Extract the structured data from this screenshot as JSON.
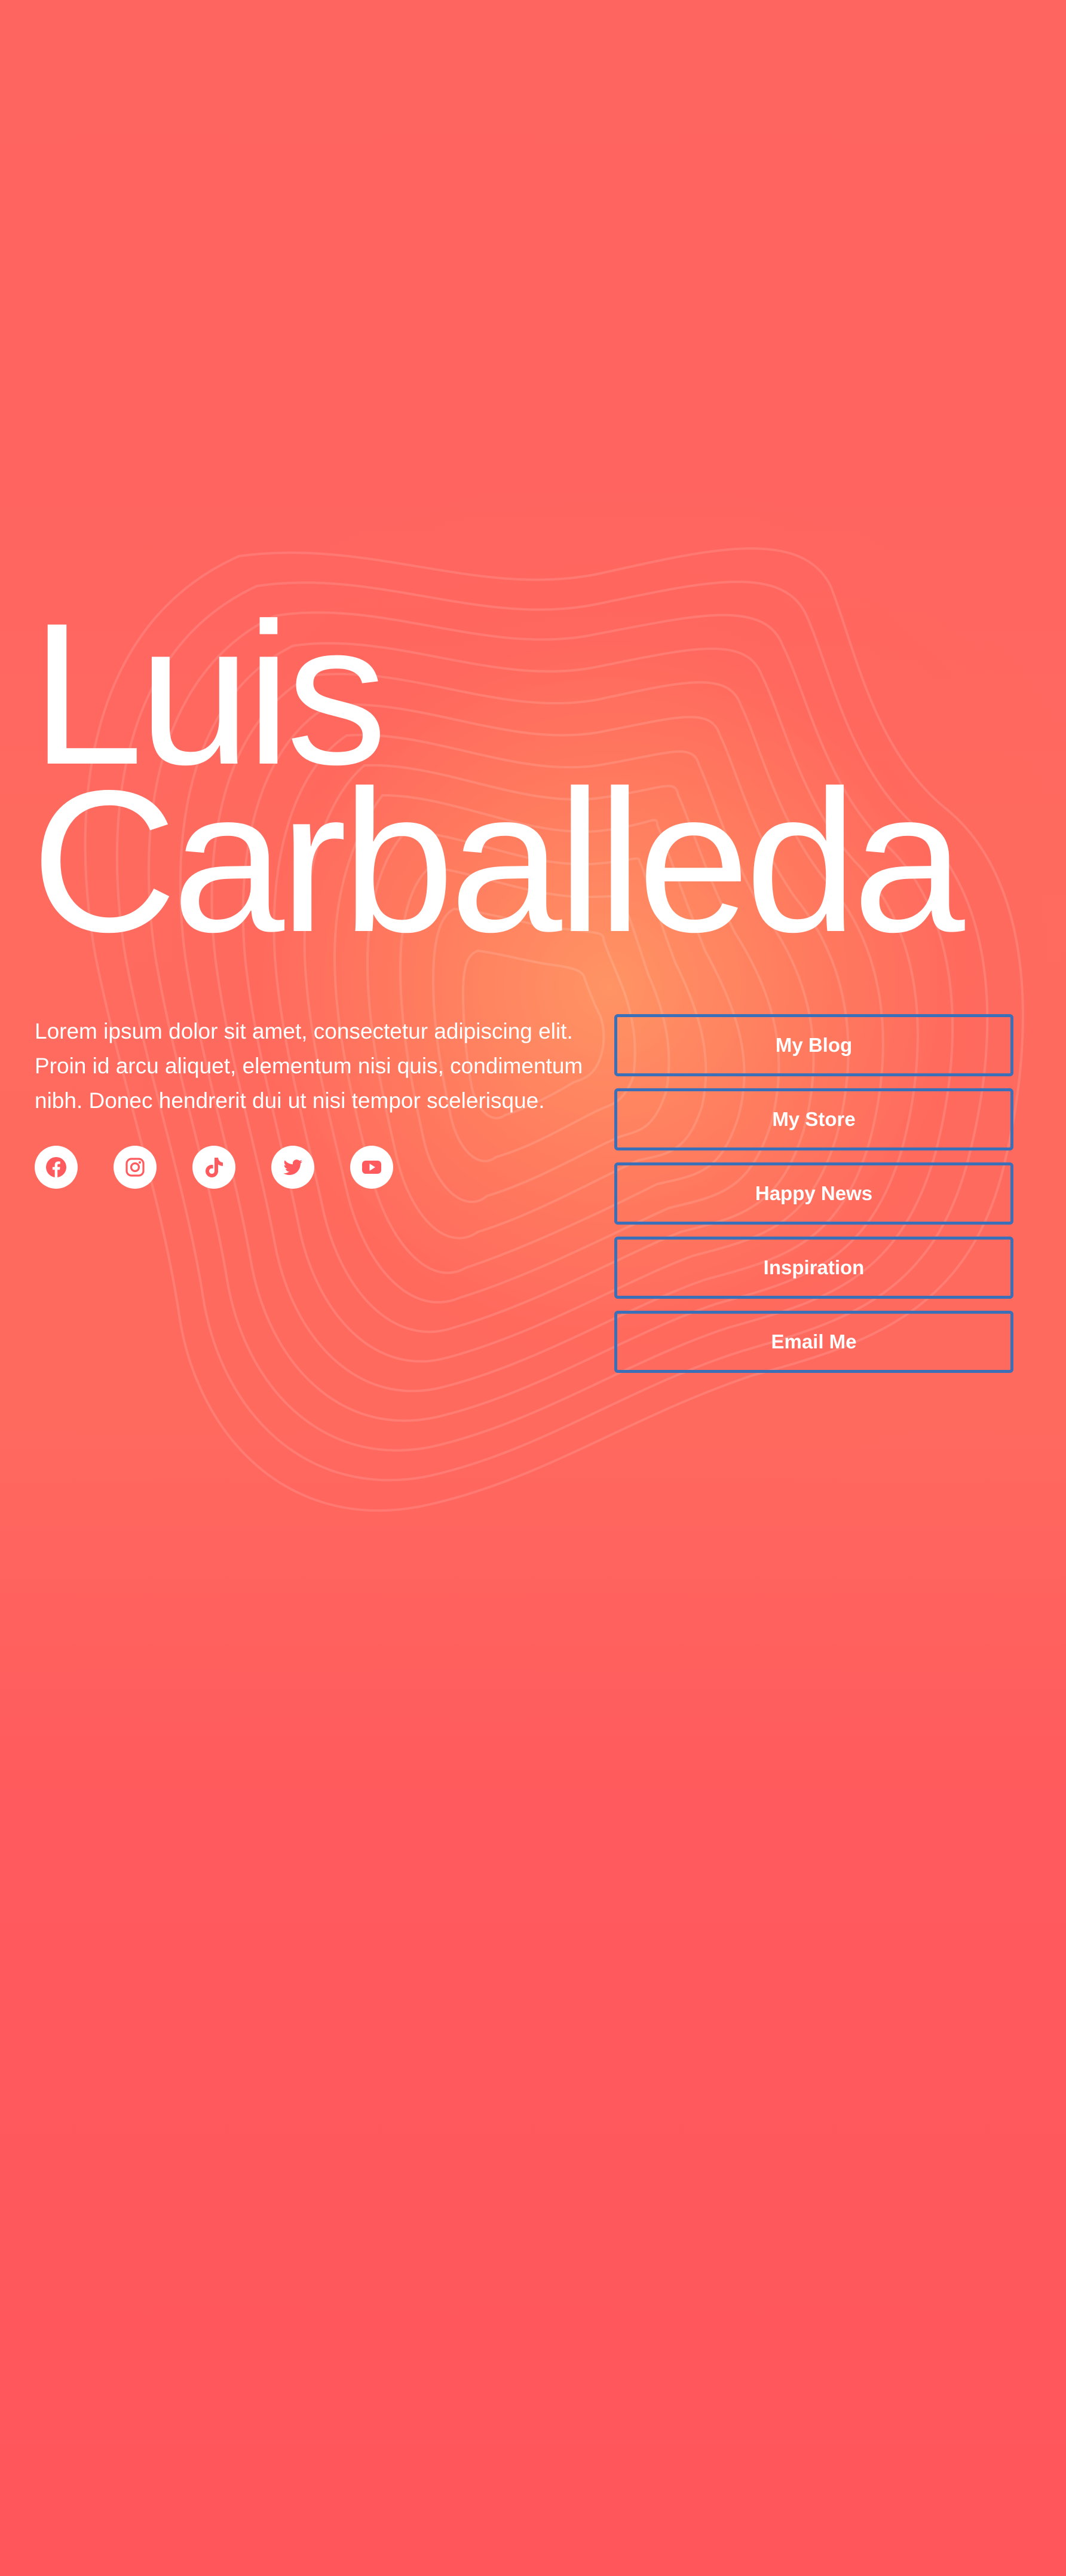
{
  "profile": {
    "first_name": "Luis",
    "last_name": "Carballeda",
    "bio": "Lorem ipsum dolor sit amet, consectetur adipiscing elit. Proin id arcu aliquet, elementum nisi quis, condimentum nibh. Donec hendrerit dui ut nisi tempor scelerisque."
  },
  "social": [
    {
      "icon": "facebook-icon"
    },
    {
      "icon": "instagram-icon"
    },
    {
      "icon": "tiktok-icon"
    },
    {
      "icon": "twitter-icon"
    },
    {
      "icon": "youtube-icon"
    }
  ],
  "links": [
    {
      "label": "My Blog"
    },
    {
      "label": "My Store"
    },
    {
      "label": "Happy News"
    },
    {
      "label": "Inspiration"
    },
    {
      "label": "Email Me"
    }
  ],
  "colors": {
    "background": "#ff5a5d",
    "glow": "#ff9a64",
    "button_border": "#3b6fb8",
    "text": "#ffffff",
    "icon": "#ff5a5d"
  }
}
